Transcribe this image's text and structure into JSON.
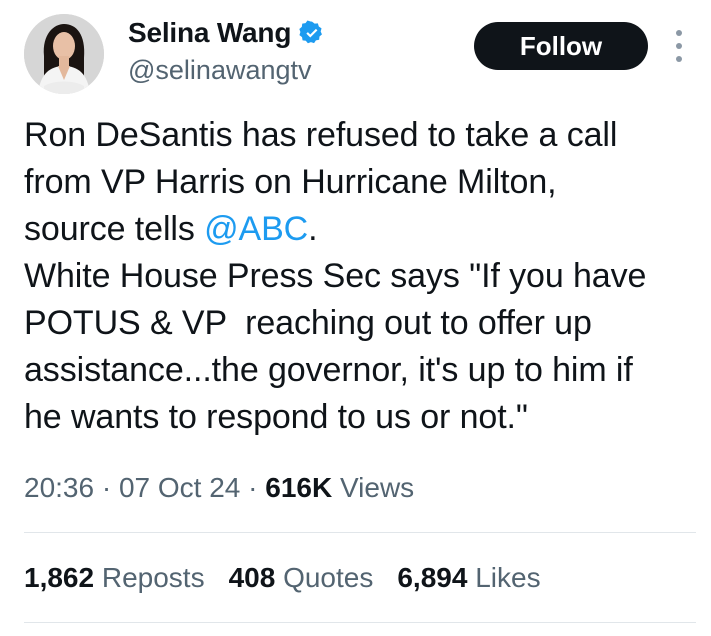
{
  "author": {
    "display_name": "Selina Wang",
    "handle": "@selinawangtv",
    "verified_icon": "verified-badge-icon",
    "avatar_icon": "profile-photo"
  },
  "follow_button": {
    "label": "Follow"
  },
  "more_icon": "more-options-icon",
  "tweet": {
    "line1": "Ron DeSantis has refused to take a call",
    "line2": "from VP Harris on Hurricane Milton,",
    "line3_prefix": "source tells ",
    "line3_mention": "@ABC",
    "line3_suffix": ".",
    "line4": "White House Press Sec says \"If you have",
    "line5": "POTUS & VP  reaching out to offer up",
    "line6": "assistance...the governor, it's up to him if",
    "line7": "he wants to respond to us or not.\""
  },
  "meta": {
    "time": "20:36",
    "sep1": " · ",
    "date": "07 Oct 24",
    "sep2": " · ",
    "views_count": "616K",
    "views_label": " Views"
  },
  "stats": {
    "reposts_count": "1,862",
    "reposts_label": " Reposts",
    "quotes_count": "408",
    "quotes_label": " Quotes",
    "likes_count": "6,894",
    "likes_label": " Likes"
  },
  "colors": {
    "link": "#1d9bf0",
    "secondary_text": "#536471",
    "primary_text": "#0f1419",
    "follow_bg": "#0f1419",
    "divider": "#e1e6ea"
  }
}
